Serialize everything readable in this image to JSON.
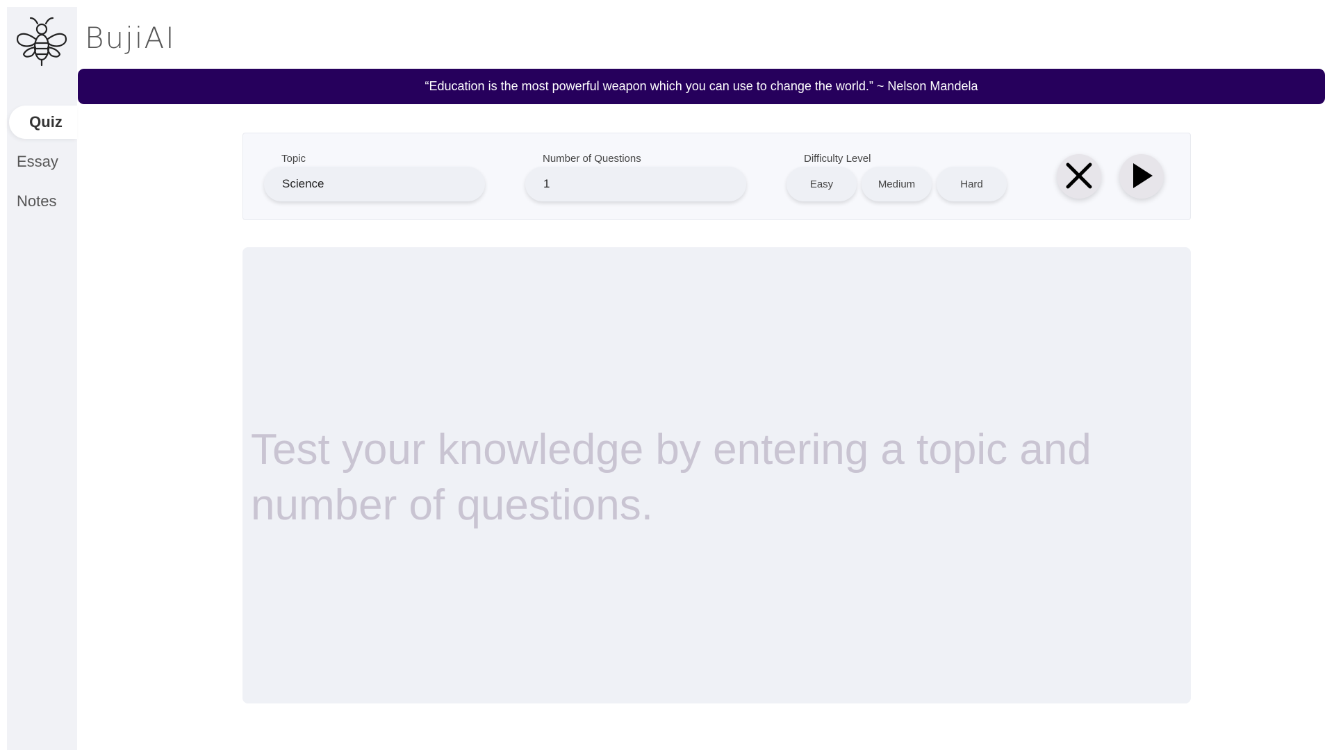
{
  "app": {
    "title": "BujiAI"
  },
  "sidebar": {
    "items": [
      {
        "label": "Quiz",
        "active": true
      },
      {
        "label": "Essay",
        "active": false
      },
      {
        "label": "Notes",
        "active": false
      }
    ]
  },
  "banner": {
    "quote": "“Education is the most powerful weapon which you can use to change the world.” ~ Nelson Mandela",
    "color": "#26005c"
  },
  "controls": {
    "topic": {
      "label": "Topic",
      "value": "Science"
    },
    "num_questions": {
      "label": "Number of Questions",
      "value": "1"
    },
    "difficulty": {
      "label": "Difficulty Level",
      "options": [
        "Easy",
        "Medium",
        "Hard"
      ]
    },
    "clear_icon": "close-icon",
    "start_icon": "play-icon"
  },
  "output": {
    "placeholder": "Test your knowledge by entering a topic and number of questions."
  }
}
